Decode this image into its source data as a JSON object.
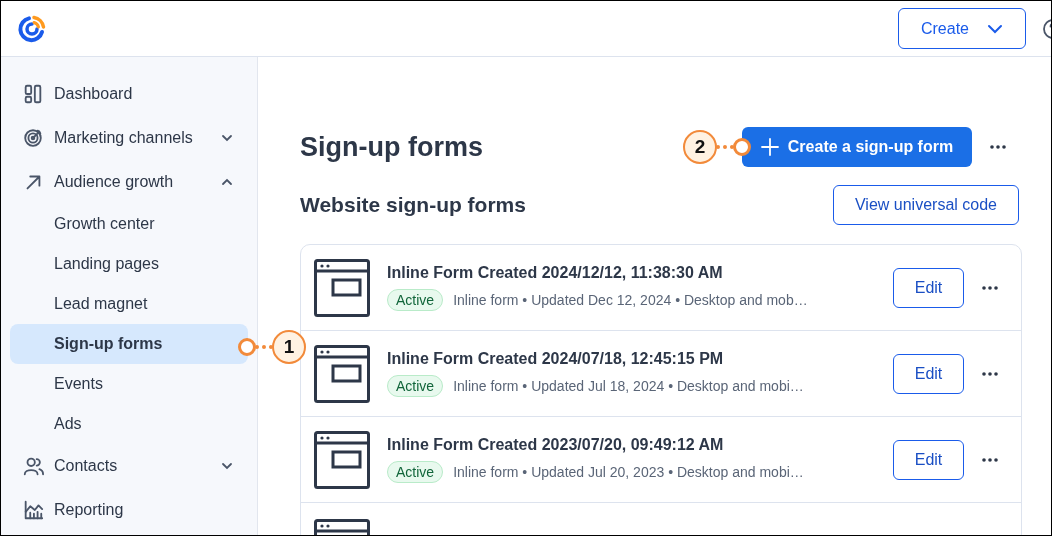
{
  "header": {
    "create_button": "Create"
  },
  "sidebar": {
    "items": [
      {
        "label": "Dashboard",
        "selected": false
      },
      {
        "label": "Marketing channels",
        "expanded": false,
        "selected": false
      },
      {
        "label": "Audience growth",
        "expanded": true,
        "selected": false,
        "children": [
          {
            "label": "Growth center",
            "selected": false
          },
          {
            "label": "Landing pages",
            "selected": false
          },
          {
            "label": "Lead magnet",
            "selected": false
          },
          {
            "label": "Sign-up forms",
            "selected": true
          },
          {
            "label": "Events",
            "selected": false
          },
          {
            "label": "Ads",
            "selected": false
          }
        ]
      },
      {
        "label": "Contacts",
        "expanded": false,
        "selected": false
      },
      {
        "label": "Reporting",
        "selected": false
      }
    ]
  },
  "page": {
    "title": "Sign-up forms",
    "primary_button": "Create a sign-up form",
    "section_title": "Website sign-up forms",
    "section_button": "View universal code"
  },
  "forms": [
    {
      "kind": "form",
      "title": "Inline Form Created 2024/12/12, 11:38:30 AM",
      "status": "Active",
      "details": "Inline form • Updated Dec 12, 2024 • Desktop and mob…",
      "button": "Edit"
    },
    {
      "kind": "form",
      "title": "Inline Form Created 2024/07/18, 12:45:15 PM",
      "status": "Active",
      "details": "Inline form • Updated Jul 18, 2024 • Desktop and mobi…",
      "button": "Edit"
    },
    {
      "kind": "form",
      "title": "Inline Form Created 2023/07/20, 09:49:12 AM",
      "status": "Active",
      "details": "Inline form • Updated Jul 20, 2023 • Desktop and mobi…",
      "button": "Edit"
    },
    {
      "kind": "partial"
    }
  ],
  "callouts": [
    {
      "number": "1"
    },
    {
      "number": "2"
    }
  ]
}
